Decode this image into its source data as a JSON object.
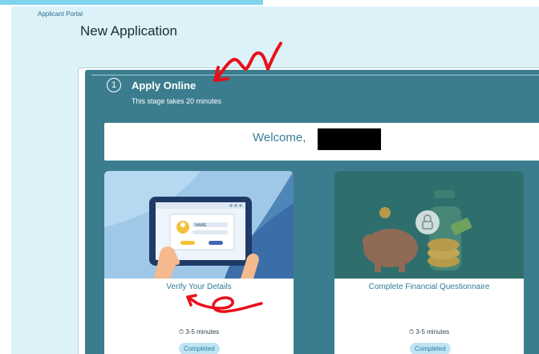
{
  "breadcrumb": "Applicant Portal",
  "page_title": "New Application",
  "stage": {
    "number": "1",
    "title": "Apply Online",
    "subtitle": "This stage takes 20 minutes"
  },
  "welcome": {
    "text": "Welcome,"
  },
  "cards": [
    {
      "title": "Verify Your Details",
      "duration": "3-5 minutes",
      "status": "Completed",
      "image_icon": "tablet-id-card-illustration"
    },
    {
      "title": "Complete Financial Questionnaire",
      "duration": "3-5 minutes",
      "status": "Completed",
      "image_icon": "piggy-bank-lock-illustration"
    }
  ],
  "illustration_text": {
    "name_field": "NAME"
  },
  "colors": {
    "stage_bg": "#3b7d8e",
    "link": "#2f7d9a",
    "badge_bg": "#bfe5f3",
    "annotation": "#e8101a",
    "page_bg": "#ddf1f8"
  }
}
